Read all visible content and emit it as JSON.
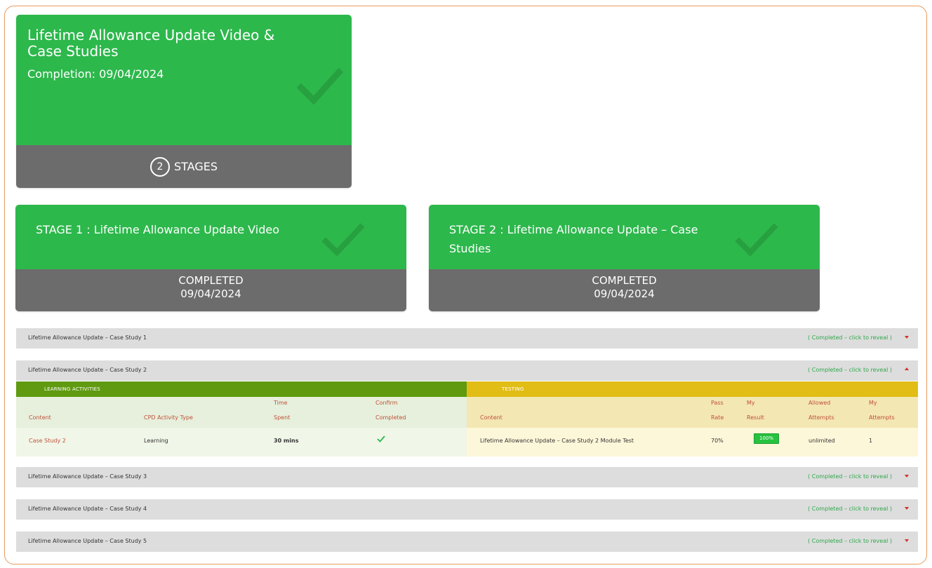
{
  "course": {
    "title": "Lifetime Allowance Update Video & Case Studies",
    "completion": "Completion: 09/04/2024",
    "stages_count": "2",
    "stages_label": "STAGES"
  },
  "stages": [
    {
      "title": "STAGE 1 : Lifetime Allowance Update Video",
      "status": "COMPLETED",
      "date": "09/04/2024"
    },
    {
      "title": "STAGE 2 : Lifetime Allowance Update – Case Studies",
      "status": "COMPLETED",
      "date": "09/04/2024"
    }
  ],
  "case_studies": [
    {
      "title": "Lifetime Allowance Update – Case Study 1",
      "status": "( Completed – click to reveal )"
    },
    {
      "title": "Lifetime Allowance Update – Case Study 2",
      "status": "( Completed – click to reveal )"
    },
    {
      "title": "Lifetime Allowance Update – Case Study 3",
      "status": "( Completed – click to reveal )"
    },
    {
      "title": "Lifetime Allowance Update – Case Study 4",
      "status": "( Completed – click to reveal )"
    },
    {
      "title": "Lifetime Allowance Update – Case Study 5",
      "status": "( Completed – click to reveal )"
    }
  ],
  "expanded": {
    "learning_header": "LEARNING ACTIVITIES",
    "testing_header": "TESTING",
    "learning_columns": {
      "content": "Content",
      "cpd_type": "CPD Activity Type",
      "time_spent_1": "Time",
      "time_spent_2": "Spent",
      "confirm_1": "Confirm",
      "confirm_2": "Completed"
    },
    "testing_columns": {
      "content": "Content",
      "pass_rate_1": "Pass",
      "pass_rate_2": "Rate",
      "my_result_1": "My",
      "my_result_2": "Result",
      "allowed_1": "Allowed",
      "allowed_2": "Attempts",
      "my_attempts_1": "My",
      "my_attempts_2": "Attempts"
    },
    "row": {
      "content": "Case Study 2",
      "cpd_type": "Learning",
      "time_spent": "30 mins",
      "test_content": "Lifetime Allowance Update – Case Study 2 Module Test",
      "pass_rate": "70%",
      "my_result": "100%",
      "allowed_attempts": "unlimited",
      "my_attempts": "1"
    }
  },
  "colors": {
    "green": "#2db84c",
    "grey": "#6c6c6c",
    "learning_green": "#5f9a10",
    "testing_yellow": "#e1bd16",
    "status_green": "#2ea84a",
    "arrow_red": "#d0312d",
    "frame_orange": "#e89a5a"
  },
  "icons": [
    "check-icon",
    "chevron-down-icon",
    "chevron-up-icon"
  ]
}
